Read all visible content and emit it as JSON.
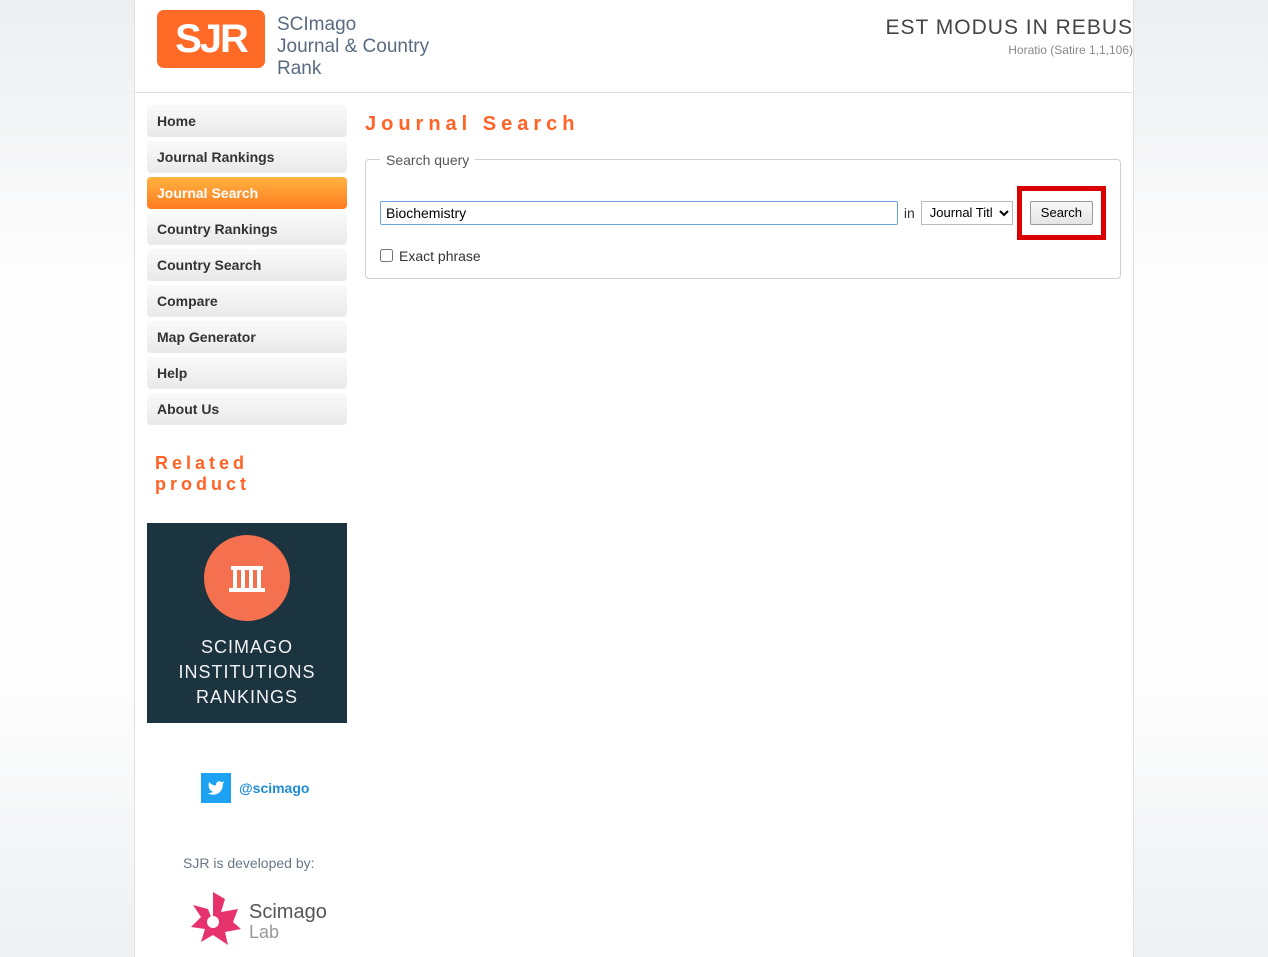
{
  "header": {
    "logo_text": "SJR",
    "subtitle_line1": "SCImago",
    "subtitle_line2": "Journal & Country",
    "subtitle_line3": "Rank",
    "motto": "EST MODUS IN REBUS",
    "motto_sub": "Horatio (Satire 1,1,106)"
  },
  "nav": {
    "items": [
      {
        "label": "Home",
        "active": false
      },
      {
        "label": "Journal Rankings",
        "active": false
      },
      {
        "label": "Journal Search",
        "active": true
      },
      {
        "label": "Country Rankings",
        "active": false
      },
      {
        "label": "Country Search",
        "active": false
      },
      {
        "label": "Compare",
        "active": false
      },
      {
        "label": "Map Generator",
        "active": false
      },
      {
        "label": "Help",
        "active": false
      },
      {
        "label": "About Us",
        "active": false
      }
    ]
  },
  "related": {
    "heading": "Related product",
    "box_line1": "SCIMAGO",
    "box_line2": "INSTITUTIONS",
    "box_line3": "RANKINGS"
  },
  "twitter": {
    "handle": "@scimago"
  },
  "developed_by": "SJR is developed by:",
  "lab": {
    "name": "Scimago",
    "sub": "Lab"
  },
  "main": {
    "title": "Journal Search",
    "legend": "Search query",
    "search_value": "Biochemistry",
    "in_label": "in",
    "field_option": "Journal Title",
    "search_button": "Search",
    "exact_label": "Exact phrase"
  }
}
